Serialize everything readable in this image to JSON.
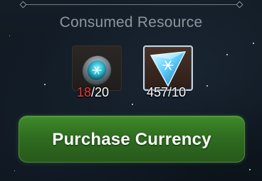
{
  "panel": {
    "title": "Consumed Resource"
  },
  "resources": [
    {
      "icon": "blue-gem-coin-icon",
      "current": "18",
      "separator": "/",
      "required": "20",
      "current_color": "#f03a32"
    },
    {
      "icon": "ice-crystal-shard-icon",
      "current": "457",
      "separator": "/",
      "required": "10"
    }
  ],
  "actions": {
    "purchase_label": "Purchase Currency"
  },
  "colors": {
    "title": "#8d969e",
    "insufficient": "#f03a32",
    "button_green": "#2f6d20"
  }
}
